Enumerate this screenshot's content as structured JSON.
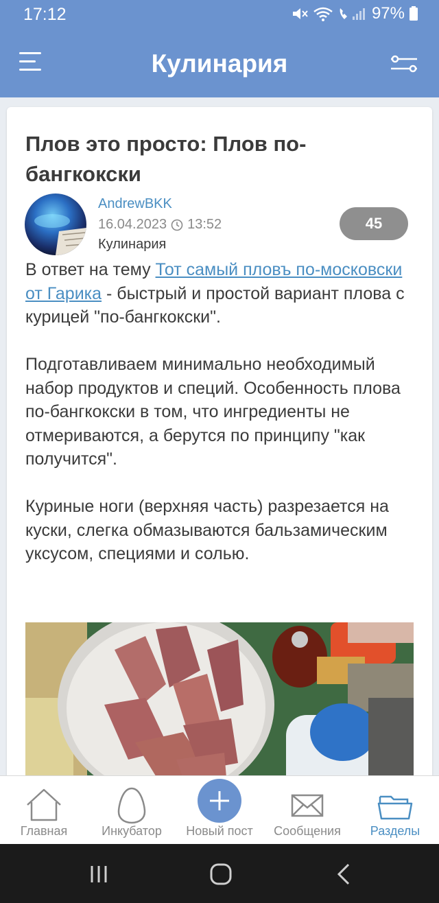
{
  "status": {
    "time": "17:12",
    "battery": "97%"
  },
  "header": {
    "title": "Кулинария"
  },
  "post": {
    "title": "Плов это просто: Плов по-бангкокски",
    "author": "AndrewBKK",
    "date": "16.04.2023",
    "time": "13:52",
    "section": "Кулинария",
    "rating": "45",
    "p1_before": "В ответ на тему ",
    "p1_link": "Тот самый пловъ по-московски от Гарика",
    "p1_after": " - быстрый и простой вариант плова с курицей \"по-бангкокски\".",
    "p2": "Подготавливаем минимально необходимый набор продуктов и специй. Особенность плова по-бангкокски в том, что ингредиенты не отмериваются, а берутся по принципу \"как получится\".",
    "p3": "Куриные ноги (верхняя часть) разрезается на куски, слегка обмазываются бальзамическим уксусом, специями и солью."
  },
  "bottom_nav": {
    "home": "Главная",
    "incubator": "Инкубатор",
    "new_post": "Новый пост",
    "messages": "Сообщения",
    "sections": "Разделы"
  },
  "colors": {
    "accent": "#6b93cf",
    "link": "#4a8ec2",
    "rating_bg": "#8f8f8f"
  }
}
